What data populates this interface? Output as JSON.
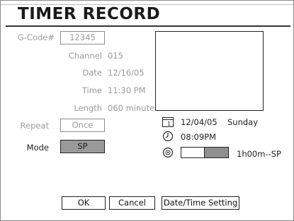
{
  "title": "TIMER RECORD",
  "form": {
    "gcode_label": "G-Code#",
    "gcode_value": "12345",
    "channel_label": "Channel",
    "channel_value": "015",
    "date_label": "Date",
    "date_value": "12/16/05",
    "time_label": "Time",
    "time_value": "11:30 PM",
    "length_label": "Length",
    "length_value": "060 minute",
    "repeat_label": "Repeat",
    "repeat_value": "Once",
    "mode_label": "Mode",
    "mode_value": "SP"
  },
  "status": {
    "date": "12/04/05",
    "day": "Sunday",
    "clock": "08:09PM",
    "remaining": "1h00m--SP",
    "disc_fill_fraction": 0.5
  },
  "buttons": {
    "ok": "OK",
    "cancel": "Cancel",
    "datetime": "Date/Time Setting"
  },
  "colors": {
    "selected": "#9a9a9a",
    "disabled_text": "#9b9b9b"
  }
}
